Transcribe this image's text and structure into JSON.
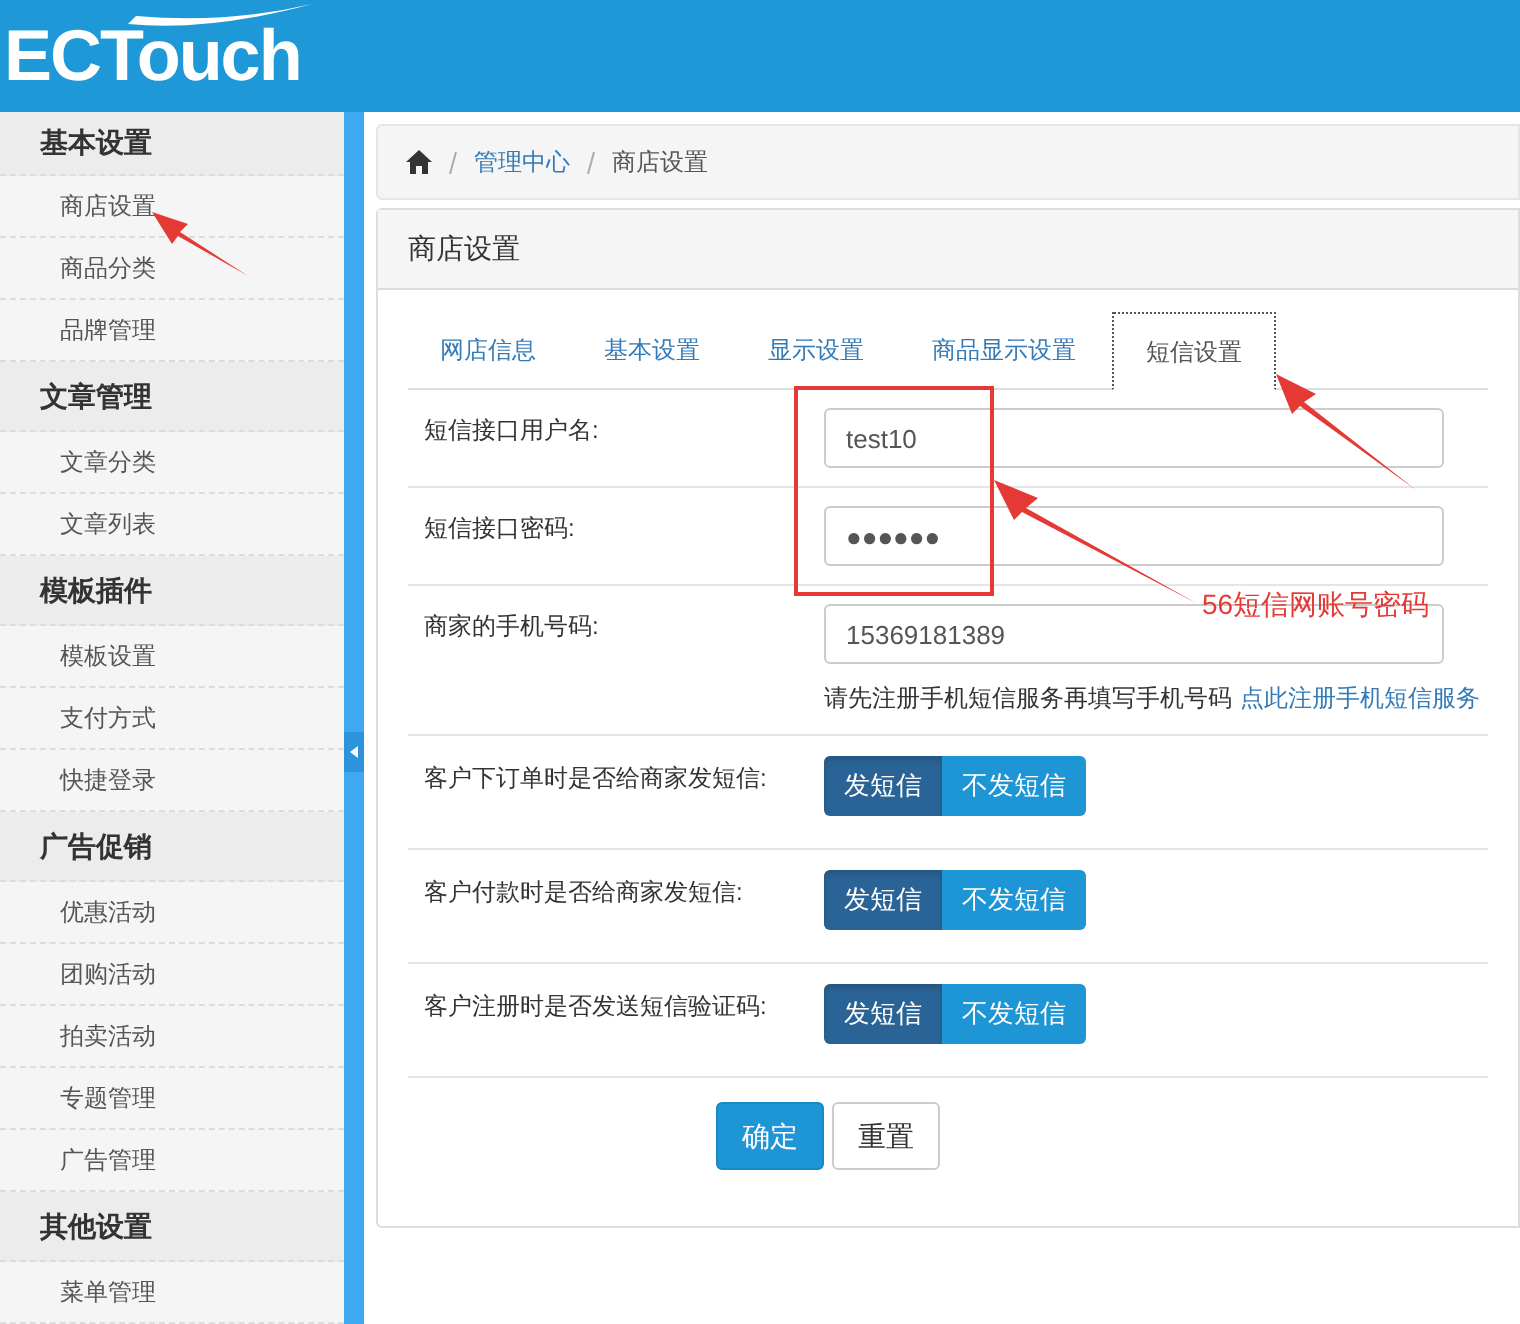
{
  "header": {
    "logo": "ECTouch"
  },
  "sidebar": {
    "groups": [
      {
        "title": "基本设置",
        "items": [
          "商店设置",
          "商品分类",
          "品牌管理"
        ]
      },
      {
        "title": "文章管理",
        "items": [
          "文章分类",
          "文章列表"
        ]
      },
      {
        "title": "模板插件",
        "items": [
          "模板设置",
          "支付方式",
          "快捷登录"
        ]
      },
      {
        "title": "广告促销",
        "items": [
          "优惠活动",
          "团购活动",
          "拍卖活动",
          "专题管理",
          "广告管理"
        ]
      },
      {
        "title": "其他设置",
        "items": [
          "菜单管理"
        ]
      }
    ]
  },
  "breadcrumb": [
    "管理中心",
    "商店设置"
  ],
  "panel": {
    "title": "商店设置",
    "tabs": [
      {
        "label": "网店信息",
        "selected": false
      },
      {
        "label": "基本设置",
        "selected": false
      },
      {
        "label": "显示设置",
        "selected": false
      },
      {
        "label": "商品显示设置",
        "selected": false
      },
      {
        "label": "短信设置",
        "selected": true
      }
    ],
    "rows": [
      {
        "kind": "input",
        "label": "短信接口用户名:",
        "value": "test10"
      },
      {
        "kind": "input",
        "label": "短信接口密码:",
        "value": "●●●●●●"
      },
      {
        "kind": "input",
        "label": "商家的手机号码:",
        "value": "15369181389",
        "help": "请先注册手机短信服务再填写手机号码",
        "link": "点此注册手机短信服务"
      },
      {
        "kind": "toggle",
        "label": "客户下订单时是否给商家发短信:",
        "options": [
          {
            "label": "发短信",
            "selected": true
          },
          {
            "label": "不发短信",
            "selected": false
          }
        ]
      },
      {
        "kind": "toggle",
        "label": "客户付款时是否给商家发短信:",
        "options": [
          {
            "label": "发短信",
            "selected": true
          },
          {
            "label": "不发短信",
            "selected": false
          }
        ]
      },
      {
        "kind": "toggle",
        "label": "客户注册时是否发送短信验证码:",
        "options": [
          {
            "label": "发短信",
            "selected": true
          },
          {
            "label": "不发短信",
            "selected": false
          }
        ]
      }
    ],
    "buttons": [
      {
        "label": "确定",
        "kind": "primary"
      },
      {
        "label": "重置",
        "kind": "default"
      }
    ]
  },
  "annotation": {
    "text": "56短信网账号密码"
  }
}
